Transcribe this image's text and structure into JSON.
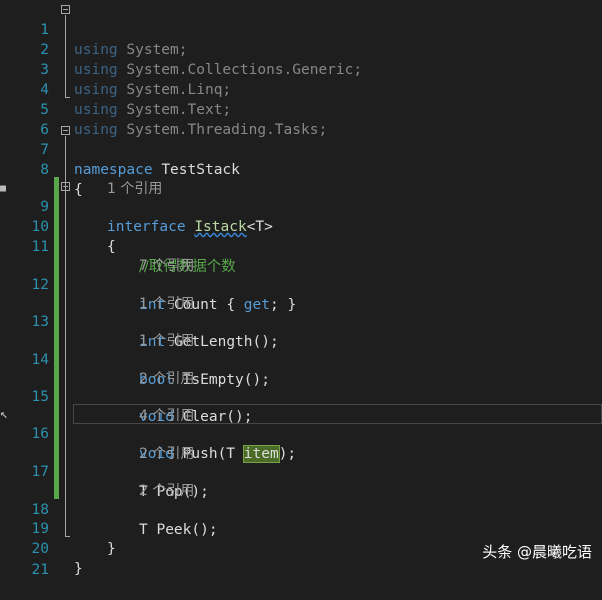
{
  "editor": {
    "line_numbers": [
      "1",
      "2",
      "3",
      "4",
      "5",
      "6",
      "7",
      "8",
      "9",
      "10",
      "11",
      "12",
      "13",
      "14",
      "15",
      "16",
      "17",
      "18",
      "19",
      "20",
      "21"
    ],
    "kw_using": "using",
    "ns_system": "System;",
    "ns_collections": "System.Collections.Generic;",
    "ns_linq": "System.Linq;",
    "ns_text": "System.Text;",
    "ns_tasks": "System.Threading.Tasks;",
    "kw_namespace": "namespace",
    "namespace_name": "TestStack",
    "brace_open": "{",
    "brace_close": "}",
    "kw_interface": "interface",
    "interface_name": "Istack",
    "interface_generic": "<T>",
    "comment": "//取得数据个数",
    "refs": {
      "interface": "1 个引用",
      "count": "7 个引用",
      "getlength": "1 个引用",
      "isempty": "1 个引用",
      "clear": "2 个引用",
      "push": "4 个引用",
      "pop": "2 个引用",
      "peek": "2 个引用"
    },
    "kw_int": "int",
    "count_name": "Count",
    "count_accessor_open": "{",
    "kw_get": "get",
    "count_accessor_close": "; }",
    "getlength_sig": "GetLength();",
    "kw_bool": "bool",
    "isempty_sig": "IsEmpty();",
    "kw_void": "void",
    "clear_sig": "Clear();",
    "push_name": "Push(T",
    "push_param": "item",
    "push_end": ");",
    "pop_sig": "T Pop();",
    "peek_sig": "T Peek();"
  },
  "watermark": "头条 @晨曦吃语"
}
